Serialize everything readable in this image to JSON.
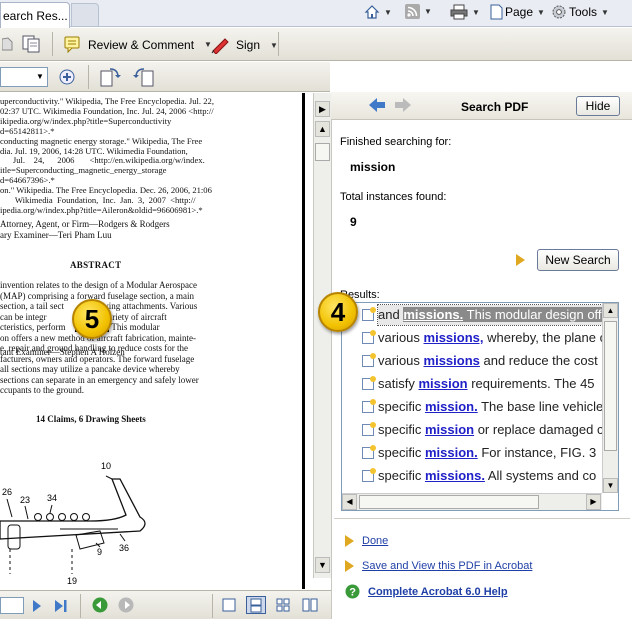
{
  "browser": {
    "tab_title": "earch Res...",
    "home_label": "",
    "page_label": "Page",
    "tools_label": "Tools"
  },
  "toolbar": {
    "review_comment_label": "Review & Comment",
    "sign_label": "Sign",
    "zoom_value": ""
  },
  "document": {
    "reference_lines": [
      "uperconductivity.\" Wikipedia, The Free Encyclopedia. Jul. 22,",
      "02:37 UTC. Wikimedia Foundation, Inc. Jul. 24, 2006 <http://",
      "ikipedia.org/w/index.php?title=Superconductivity",
      "d=65142811>.*",
      "conducting magnetic energy storage.\" Wikipedia, The Free",
      "dia. Jul. 19, 2006, 14:28 UTC. Wikimedia Foundation,",
      "      Jul.    24,      2006       <http://en.wikipedia.org/w/index.",
      "itle=Superconducting_magnetic_energy_storage",
      "d=64667396>.*",
      "on.\" Wikipedia. The Free Encyclopedia. Dec. 26, 2006, 21:06",
      "       Wikimedia  Foundation,  Inc.  Jan.  3,  2007  <http://",
      "ipedia.org/w/index.php?title=Aileron&oldid=96606981>.*"
    ],
    "examiner_lines": [
      "ary Examiner—Teri Pham Luu",
      "tant Examiner—Stephen A Holzen",
      "Attorney, Agent, or Firm—Rodgers & Rodgers"
    ],
    "abstract_heading": "ABSTRACT",
    "abstract_lines": [
      "invention relates to the design of a Modular Aerospace",
      "(MAP) comprising a forward fuselage section, a main",
      "section, a tail sect                 wing attachments. Various",
      "can be integr              offer a variety of aircraft",
      "cteristics, perform",
      "on offers a new method of aircraft fabrication, mainte-",
      "e, repair and ground handling to reduce costs for the",
      "facturers, owners and operators. The forward fuselage",
      "all sections may utilize a pancake device whereby",
      "sections can separate in an emergency and safely lower",
      "ccupants to the ground."
    ],
    "abstract_highlight": "missions.",
    "abstract_line5_tail": " This modular",
    "claims_line": "14 Claims, 6 Drawing Sheets",
    "drawing_labels": [
      "10",
      "26",
      "23",
      "34",
      "36",
      "9",
      "19"
    ]
  },
  "search_panel": {
    "title": "Search PDF",
    "hide_label": "Hide",
    "finished_label": "Finished searching for:",
    "search_term": "mission",
    "total_label": "Total instances found:",
    "total_count": "9",
    "new_search_label": "New Search",
    "results_label": "Results:",
    "results": [
      {
        "pre": "and ",
        "kw": "missions.",
        "post": " This modular design offers"
      },
      {
        "pre": "various ",
        "kw": "missions,",
        "post": " whereby, the plane c"
      },
      {
        "pre": "various ",
        "kw": "missions",
        "post": " and reduce the cost"
      },
      {
        "pre": "satisfy ",
        "kw": "mission",
        "post": " requirements. The 45"
      },
      {
        "pre": "specific ",
        "kw": "mission.",
        "post": " The base line vehicle"
      },
      {
        "pre": "specific ",
        "kw": "mission",
        "post": " or replace damaged c"
      },
      {
        "pre": "specific ",
        "kw": "mission.",
        "post": " For instance, FIG. 3"
      },
      {
        "pre": "specific ",
        "kw": "missions.",
        "post": " All systems and co"
      }
    ],
    "done_label": "Done",
    "save_view_label": "Save and View this PDF in Acrobat",
    "help_label": "Complete Acrobat 6.0 Help"
  },
  "callouts": {
    "left": "5",
    "right": "4"
  },
  "colors": {
    "link": "#1f3fa6",
    "keyword": "#2020c8",
    "callout": "#f2c200"
  }
}
